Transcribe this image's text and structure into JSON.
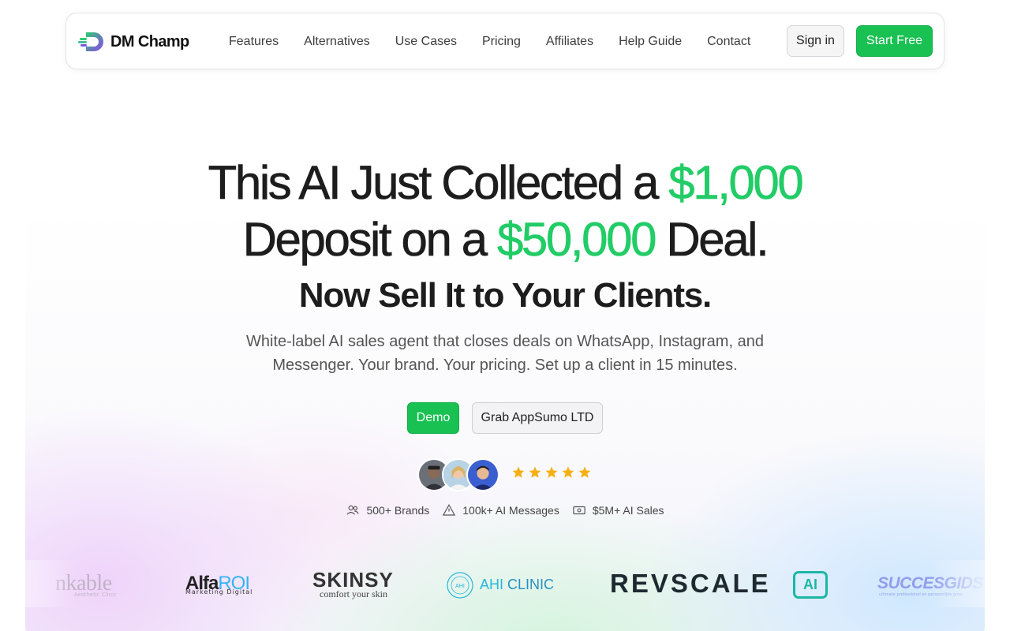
{
  "brand": {
    "name": "DM Champ",
    "accent": "#19c153"
  },
  "nav": {
    "links": [
      "Features",
      "Alternatives",
      "Use Cases",
      "Pricing",
      "Affiliates",
      "Help Guide",
      "Contact"
    ],
    "sign_in": "Sign in",
    "start_free": "Start Free"
  },
  "hero": {
    "headline_part1": "This AI Just Collected a ",
    "headline_amount1": "$1,000",
    "headline_part2": "Deposit on a ",
    "headline_amount2": "$50,000",
    "headline_part3": " Deal.",
    "subheadline": "Now Sell It to Your Clients.",
    "description": "White-label AI sales agent that closes deals on WhatsApp, Instagram, and Messenger. Your brand. Your pricing. Set up a client in 15 minutes.",
    "demo_button": "Demo",
    "appsumo_button": "Grab AppSumo LTD",
    "rating_stars": 5,
    "star_color": "#f5b014"
  },
  "stats": [
    {
      "icon": "users-icon",
      "label": "500+ Brands"
    },
    {
      "icon": "triangle-icon",
      "label": "100k+ AI Messages"
    },
    {
      "icon": "money-icon",
      "label": "$5M+ AI Sales"
    }
  ],
  "logos": {
    "linkable": "nkable",
    "linkable_sub": "Aesthetic Clinic",
    "alfa": "Alfa",
    "alfa_roi": "ROI",
    "alfa_sub": "Marketing Digital",
    "skinsy": "SKINSY",
    "skinsy_sub": "comfort your skin",
    "ahi": "AHI",
    "ahi_clinic": " CLINIC",
    "ahi_mark": "AHI",
    "revscale": "REVSCALE",
    "revscale_ai": "AI",
    "succes": "SUCCESGIDS",
    "succes_sub": "ultimate professional en persoonlijke groei"
  }
}
